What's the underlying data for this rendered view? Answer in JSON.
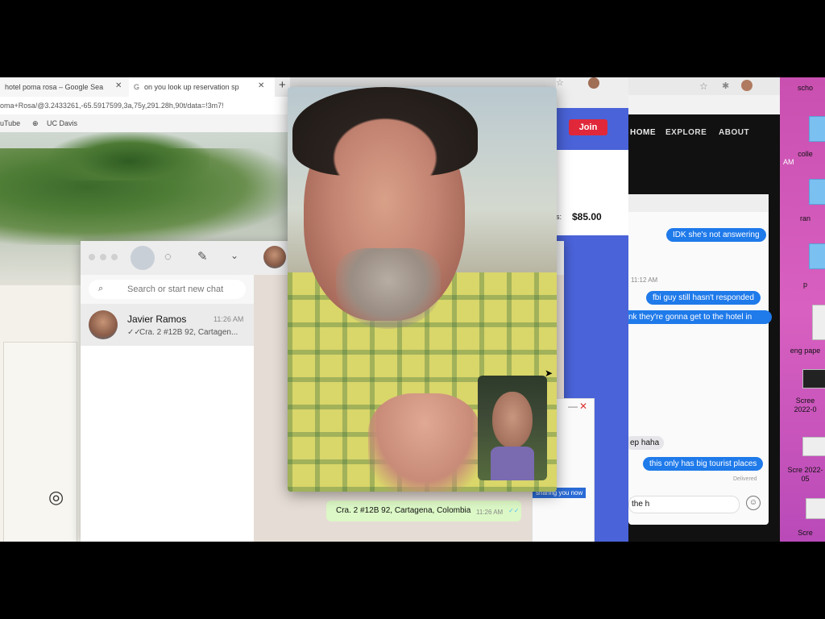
{
  "browser": {
    "tab1": "hotel poma rosa – Google Sea",
    "tab2": "on you look up reservation sp",
    "new_tab": "+",
    "url": "oma+Rosa/@3.2433261,-65.5917599,3a,75y,291.28h,90t/data=!3m7!",
    "bookmark_youtube": "uTube",
    "bookmark_ucdavis": "UC Davis"
  },
  "booking": {
    "join_label": "Join",
    "price": "$85.00",
    "price_prefix": "s:"
  },
  "site_nav": {
    "home": "HOME",
    "explore": "EXPLORE",
    "about": "ABOUT",
    "am_label": "AM"
  },
  "messages": {
    "bubbles": [
      "IDK she's not answering",
      "fbi guy still hasn't responded",
      "nk they're gonna get to the hotel in",
      "this only has big tourist places"
    ],
    "timestamp": "11:12 AM",
    "incoming": "ep haha",
    "delivered": "Delivered",
    "input_value": "the h"
  },
  "whatsapp": {
    "search_placeholder": "Search or start new chat",
    "contact_name": "Javier Ramos",
    "contact_time": "11:26 AM",
    "contact_preview": "Cra. 2 #12B 92, Cartagen...",
    "message_text": "Cra. 2 #12B 92, Cartagena, Colombia",
    "message_time": "11:26 AM",
    "overlay_text": "sharing you now"
  },
  "desktop": {
    "items": [
      "scho",
      "colle",
      "ran",
      "p",
      "eng pape",
      "Scree 2022-0",
      "Scre 2022-05",
      "Scre"
    ]
  },
  "colors": {
    "accent_blue": "#1f7aea",
    "join_red": "#e0283a",
    "whatsapp_green": "#dcf8c6",
    "pink_desktop": "#d34fb4"
  }
}
